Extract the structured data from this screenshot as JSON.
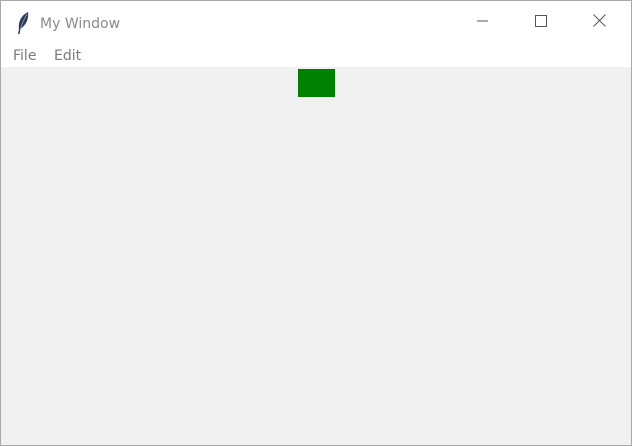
{
  "window": {
    "title": "My Window",
    "icon": "feather-icon"
  },
  "caption_buttons": {
    "minimize_icon": "minimize-icon",
    "maximize_icon": "maximize-icon",
    "close_icon": "close-icon"
  },
  "menubar": {
    "items": [
      {
        "label": "File"
      },
      {
        "label": "Edit"
      }
    ]
  },
  "canvas": {
    "box_color": "#008000",
    "background_color": "#f0f0f0"
  }
}
